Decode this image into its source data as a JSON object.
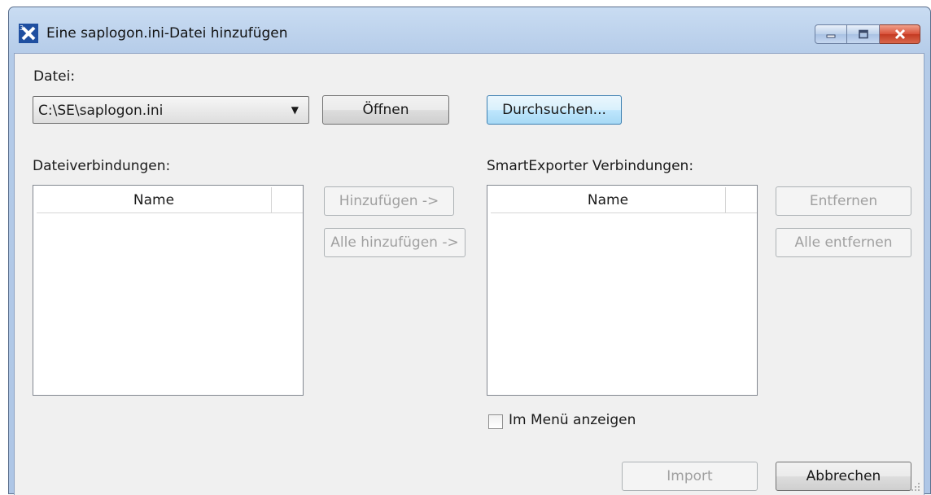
{
  "window": {
    "title": "Eine saplogon.ini-Datei hinzufügen",
    "icon": "app-x-icon",
    "buttons": [
      "minimize-icon",
      "maximize-icon",
      "close-icon"
    ]
  },
  "file": {
    "label": "Datei:",
    "selected": "C:\\SE\\saplogon.ini",
    "open_label": "Öffnen",
    "browse_label": "Durchsuchen..."
  },
  "file_connections": {
    "label": "Dateiverbindungen:",
    "column": "Name",
    "rows": []
  },
  "middle_buttons": {
    "add": "Hinzufügen ->",
    "add_all": "Alle hinzufügen ->"
  },
  "se_connections": {
    "label": "SmartExporter Verbindungen:",
    "column": "Name",
    "rows": []
  },
  "right_buttons": {
    "remove": "Entfernen",
    "remove_all": "Alle entfernen"
  },
  "show_in_menu": {
    "label": "Im Menü anzeigen",
    "checked": false
  },
  "footer": {
    "import": "Import",
    "cancel": "Abbrechen"
  }
}
